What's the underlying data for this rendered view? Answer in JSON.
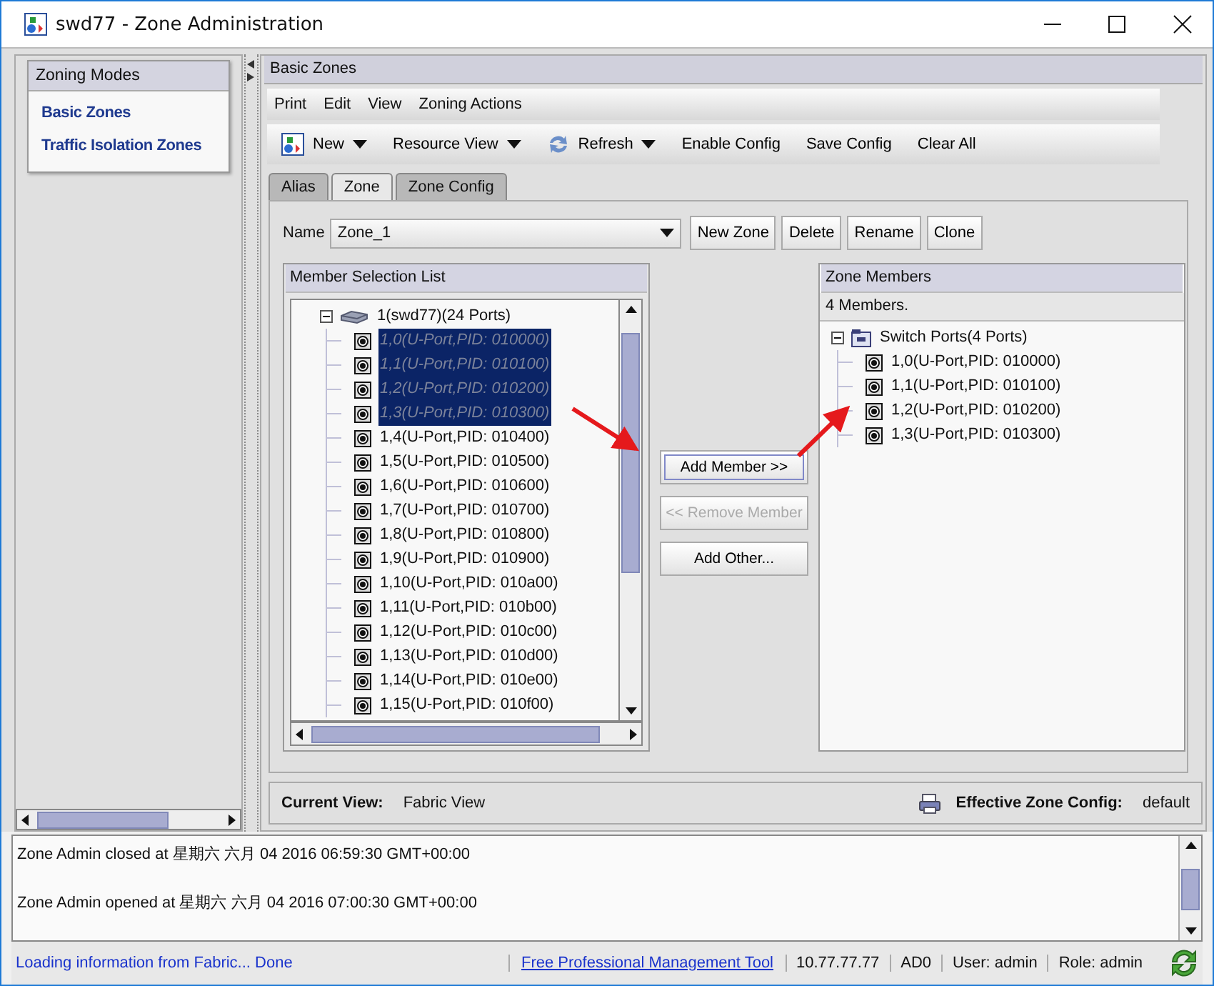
{
  "window": {
    "title": "swd77 - Zone Administration"
  },
  "sidebar": {
    "title": "Zoning Modes",
    "items": [
      "Basic Zones",
      "Traffic Isolation Zones"
    ]
  },
  "panel_title": "Basic Zones",
  "menu": [
    "Print",
    "Edit",
    "View",
    "Zoning Actions"
  ],
  "toolbar": [
    {
      "label": "New",
      "dropdown": true
    },
    {
      "label": "Resource View",
      "dropdown": true
    },
    {
      "label": "Refresh",
      "dropdown": true
    },
    {
      "label": "Enable Config",
      "dropdown": false
    },
    {
      "label": "Save Config",
      "dropdown": false
    },
    {
      "label": "Clear All",
      "dropdown": false
    }
  ],
  "tabs": [
    {
      "label": "Alias",
      "selected": false
    },
    {
      "label": "Zone",
      "selected": true
    },
    {
      "label": "Zone Config",
      "selected": false
    }
  ],
  "name_field": {
    "label": "Name",
    "value": "Zone_1"
  },
  "zone_buttons": [
    "New Zone",
    "Delete",
    "Rename",
    "Clone"
  ],
  "member_list": {
    "title": "Member Selection List",
    "tree": [
      {
        "label": "1(swd77)(24 Ports)",
        "kind": "switch",
        "expanded": true,
        "selected": false,
        "children": [
          {
            "label": "1,0(U-Port,PID: 010000)",
            "kind": "port",
            "selected": true
          },
          {
            "label": "1,1(U-Port,PID: 010100)",
            "kind": "port",
            "selected": true
          },
          {
            "label": "1,2(U-Port,PID: 010200)",
            "kind": "port",
            "selected": true
          },
          {
            "label": "1,3(U-Port,PID: 010300)",
            "kind": "port",
            "selected": true
          },
          {
            "label": "1,4(U-Port,PID: 010400)",
            "kind": "port",
            "selected": false
          },
          {
            "label": "1,5(U-Port,PID: 010500)",
            "kind": "port",
            "selected": false
          },
          {
            "label": "1,6(U-Port,PID: 010600)",
            "kind": "port",
            "selected": false
          },
          {
            "label": "1,7(U-Port,PID: 010700)",
            "kind": "port",
            "selected": false
          },
          {
            "label": "1,8(U-Port,PID: 010800)",
            "kind": "port",
            "selected": false
          },
          {
            "label": "1,9(U-Port,PID: 010900)",
            "kind": "port",
            "selected": false
          },
          {
            "label": "1,10(U-Port,PID: 010a00)",
            "kind": "port",
            "selected": false
          },
          {
            "label": "1,11(U-Port,PID: 010b00)",
            "kind": "port",
            "selected": false
          },
          {
            "label": "1,12(U-Port,PID: 010c00)",
            "kind": "port",
            "selected": false
          },
          {
            "label": "1,13(U-Port,PID: 010d00)",
            "kind": "port",
            "selected": false
          },
          {
            "label": "1,14(U-Port,PID: 010e00)",
            "kind": "port",
            "selected": false
          },
          {
            "label": "1,15(U-Port,PID: 010f00)",
            "kind": "port",
            "selected": false
          }
        ]
      }
    ]
  },
  "member_buttons": [
    {
      "label": "Add Member >>",
      "disabled": false
    },
    {
      "label": "<< Remove Member",
      "disabled": true
    },
    {
      "label": "Add Other...",
      "disabled": false
    }
  ],
  "zone_members": {
    "title": "Zone Members",
    "count": "4 Members.",
    "tree": [
      {
        "label": "Switch Ports(4 Ports)",
        "kind": "group",
        "expanded": true,
        "selected": false,
        "children": [
          {
            "label": "1,0(U-Port,PID: 010000)",
            "kind": "port",
            "selected": false
          },
          {
            "label": "1,1(U-Port,PID: 010100)",
            "kind": "port",
            "selected": false
          },
          {
            "label": "1,2(U-Port,PID: 010200)",
            "kind": "port",
            "selected": false
          },
          {
            "label": "1,3(U-Port,PID: 010300)",
            "kind": "port",
            "selected": false
          }
        ]
      }
    ]
  },
  "footer": {
    "current_view_label": "Current View:",
    "current_view": "Fabric View",
    "effective_label": "Effective Zone Config:",
    "effective": "default"
  },
  "log": [
    "Zone Admin closed at 星期六 六月 04 2016 06:59:30 GMT+00:00",
    "Zone Admin opened at 星期六 六月 04 2016 07:00:30 GMT+00:00"
  ],
  "status_bar": {
    "message": "Loading information from Fabric... Done",
    "link": "Free Professional Management Tool",
    "ip": "10.77.77.77",
    "domain": "AD0",
    "user": "User: admin",
    "role": "Role: admin"
  }
}
